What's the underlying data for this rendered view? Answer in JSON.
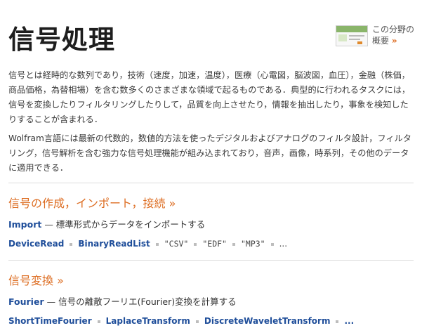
{
  "page": {
    "title": "信号処理"
  },
  "overview_link": {
    "line1": "この分野の",
    "line2": "概要",
    "arrow": "»"
  },
  "intro": {
    "p1": "信号とは経時的な数列であり，技術（速度，加速，温度），医療（心電図，脳波図，血圧），金融（株価，商品価格，為替相場）を含む数多くのさまざまな領域で起るものである．典型的に行われるタスクには，信号を変換したりフィルタリングしたりして，品質を向上させたり，情報を抽出したり，事象を検知したりすることが含まれる．",
    "p2": "Wolfram言語には最新の代数的，数値的方法を使ったデジタルおよびアナログのフィルタ設計，フィルタリング，信号解析を含む強力な信号処理機能が組み込まれており，音声，画像，時系列，その他のデータに適用できる．"
  },
  "sections": [
    {
      "title": "信号の作成，インポート，接続",
      "arrow": "»",
      "main_fn": "Import",
      "main_desc": " — 標準形式からデータをインポートする",
      "items": [
        "DeviceRead",
        "BinaryReadList",
        "\"CSV\"",
        "\"EDF\"",
        "\"MP3\""
      ],
      "more": "..."
    },
    {
      "title": "信号変換",
      "arrow": "»",
      "main_fn": "Fourier",
      "main_desc": " — 信号の離散フーリエ(Fourier)変換を計算する",
      "items": [
        "ShortTimeFourier",
        "LaplaceTransform",
        "DiscreteWaveletTransform"
      ],
      "more": "..."
    }
  ]
}
